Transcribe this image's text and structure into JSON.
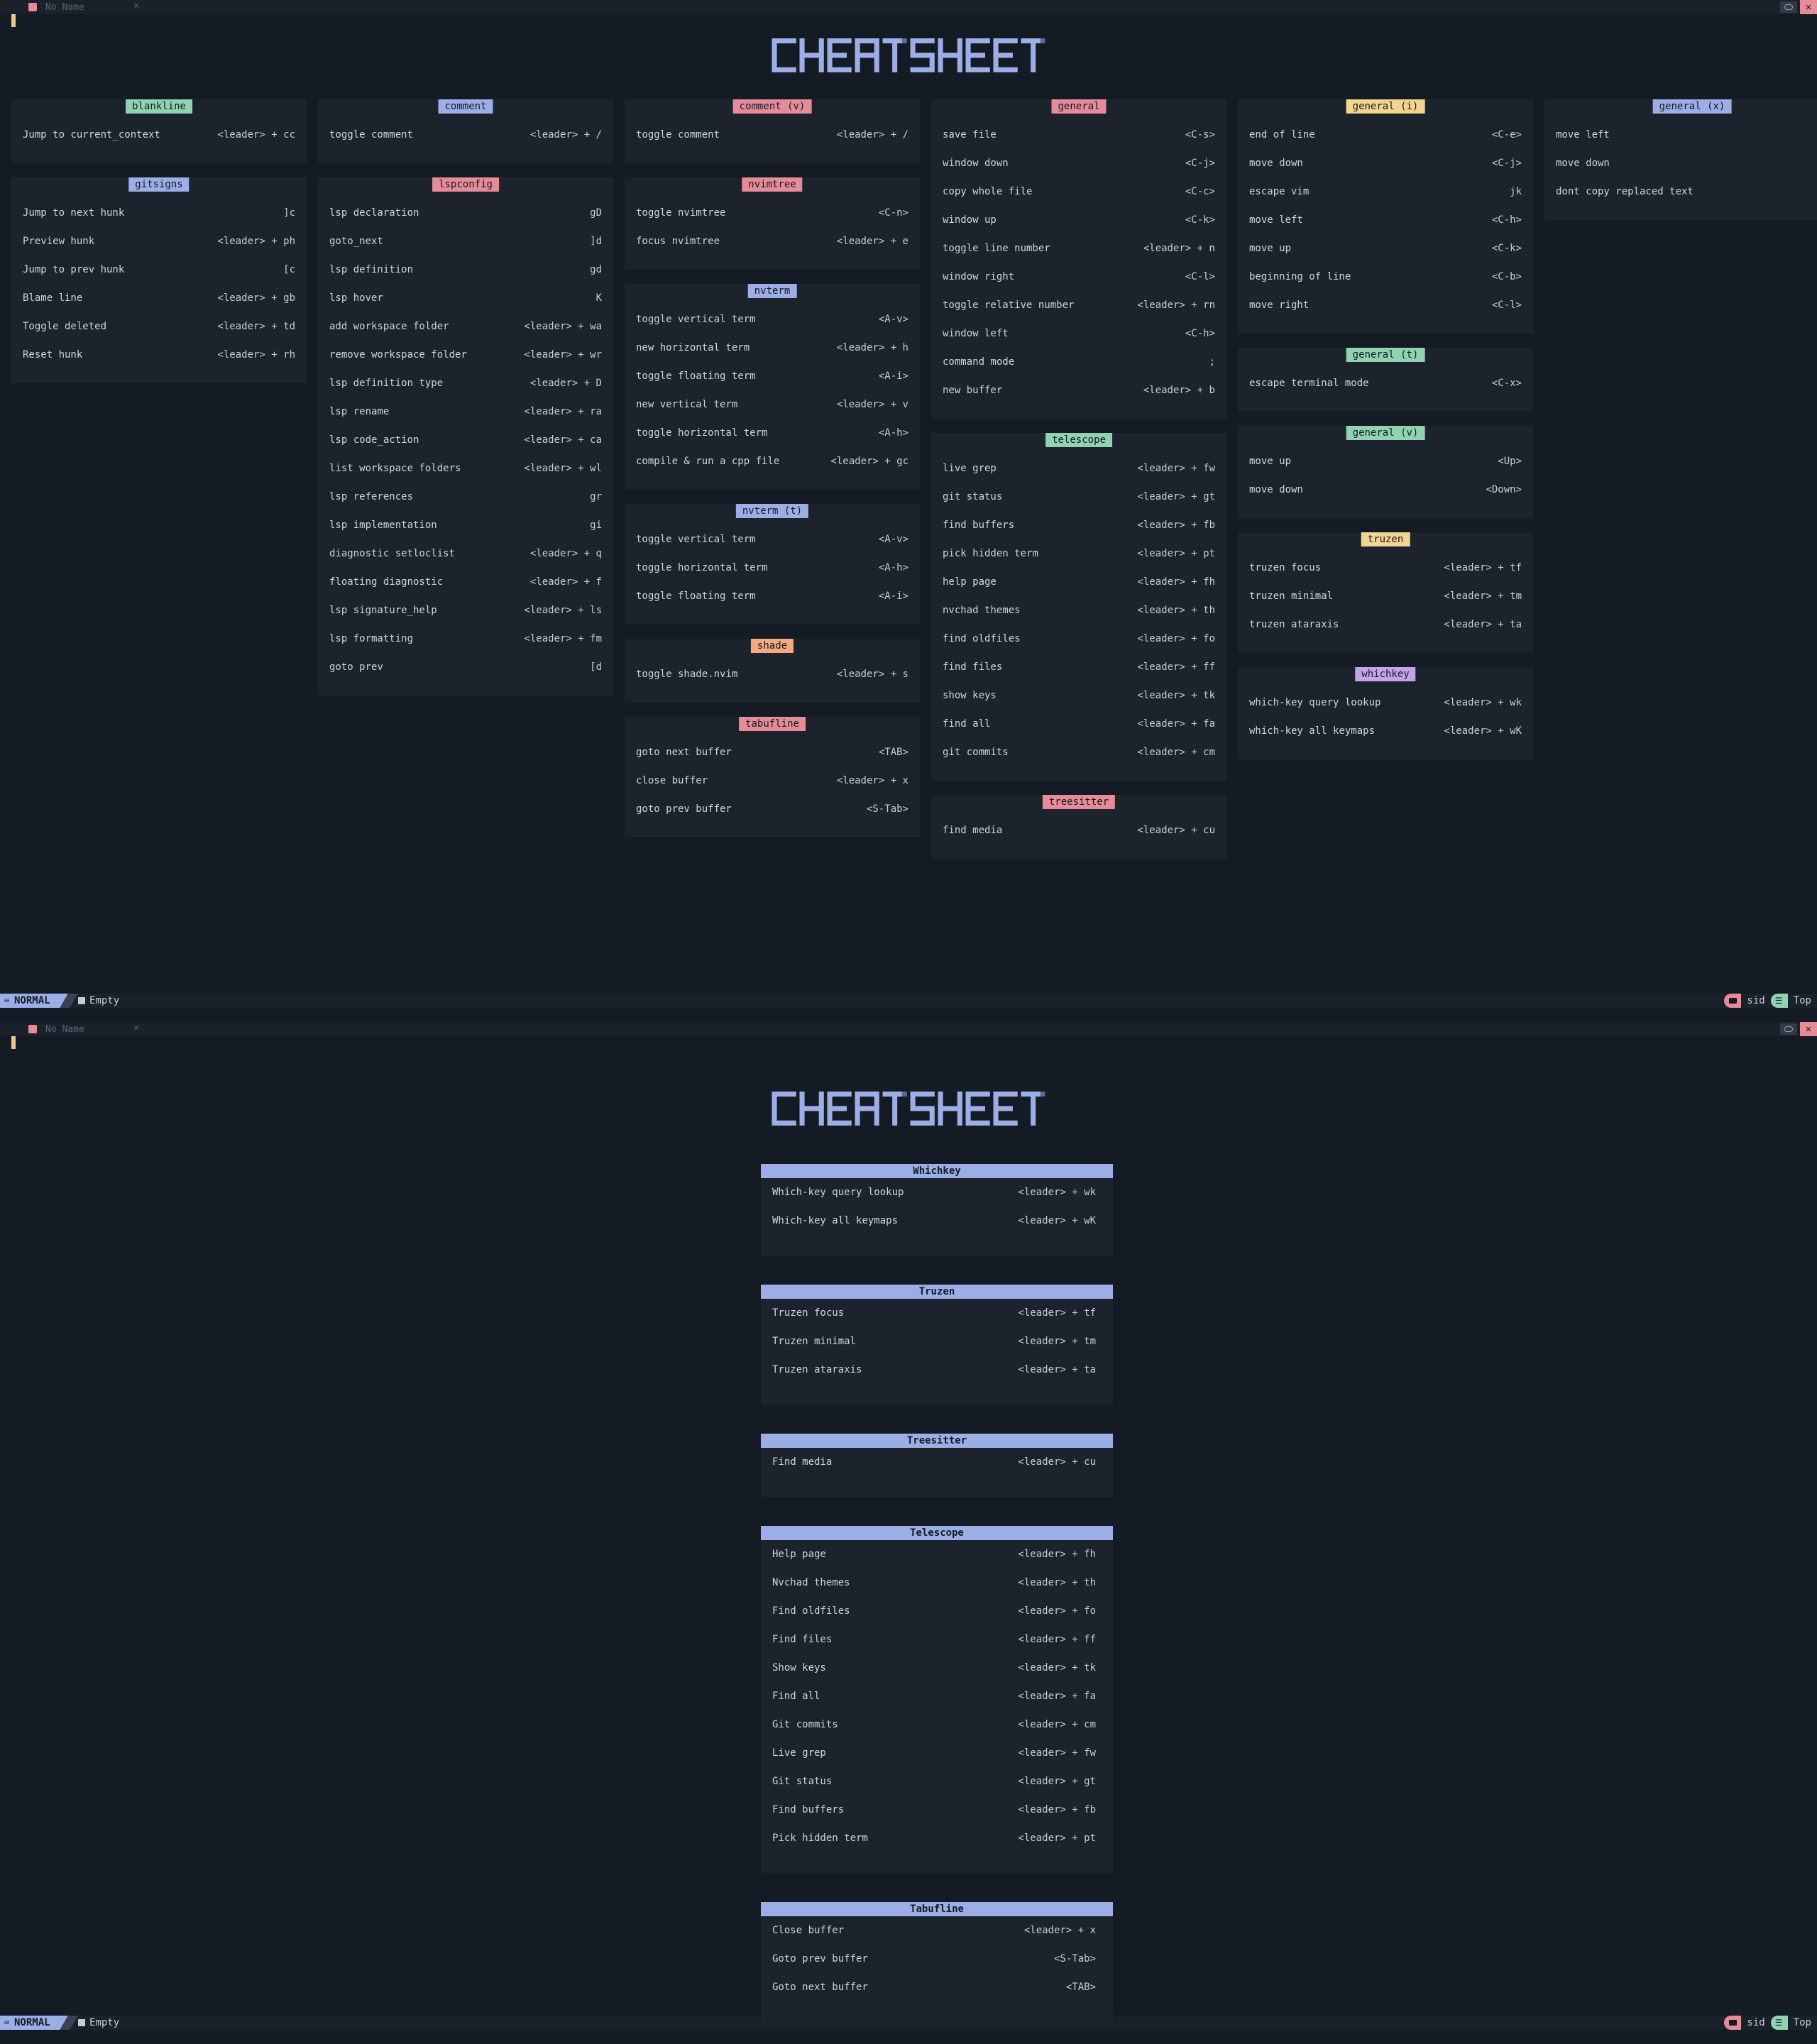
{
  "tabline": {
    "buffer_name": "No Name",
    "close": "×"
  },
  "statusline": {
    "mode": "NORMAL",
    "file": "Empty",
    "cwd": "sid",
    "position": "Top"
  },
  "colors": {
    "green": "#8fd3b0",
    "blue": "#9caee6",
    "red": "#e58c98",
    "orange": "#f5a97f",
    "yellow": "#f3d590",
    "purple": "#c5a3e8",
    "bg": "#141b24",
    "card": "#1c232d"
  },
  "grid": [
    {
      "title": "blankline",
      "color": "green",
      "items": [
        [
          "Jump to current_context",
          "<leader> + cc"
        ]
      ]
    },
    {
      "title": "comment",
      "color": "blue",
      "items": [
        [
          "toggle comment",
          "<leader> + /"
        ]
      ]
    },
    {
      "title": "comment (v)",
      "color": "red",
      "items": [
        [
          "toggle comment",
          "<leader> + /"
        ]
      ]
    },
    {
      "title": "general",
      "color": "red",
      "items": [
        [
          "save file",
          "<C-s>"
        ],
        [
          "window down",
          "<C-j>"
        ],
        [
          "copy whole file",
          "<C-c>"
        ],
        [
          "window up",
          "<C-k>"
        ],
        [
          "toggle line number",
          "<leader> + n"
        ],
        [
          "window right",
          "<C-l>"
        ],
        [
          "toggle relative number",
          "<leader> + rn"
        ],
        [
          "window left",
          "<C-h>"
        ],
        [
          "command mode",
          ";"
        ],
        [
          "new buffer",
          "<leader> + b"
        ]
      ]
    },
    {
      "title": "general (i)",
      "color": "yellow",
      "items": [
        [
          "end of line",
          "<C-e>"
        ],
        [
          "move down",
          "<C-j>"
        ],
        [
          "escape vim",
          "jk"
        ],
        [
          "move left",
          "<C-h>"
        ],
        [
          "move up",
          "<C-k>"
        ],
        [
          "beginning of line",
          "<C-b>"
        ],
        [
          "move right",
          "<C-l>"
        ]
      ]
    },
    {
      "title": "general (x)",
      "color": "blue",
      "items": [
        [
          "move left",
          ""
        ],
        [
          "move down",
          ""
        ],
        [
          "dont copy replaced text",
          ""
        ]
      ]
    },
    {
      "title": "gitsigns",
      "color": "blue",
      "items": [
        [
          "Jump to next hunk",
          "]c"
        ],
        [
          "Preview hunk",
          "<leader> + ph"
        ],
        [
          "Jump to prev hunk",
          "[c"
        ],
        [
          "Blame line",
          "<leader> + gb"
        ],
        [
          "Toggle deleted",
          "<leader> + td"
        ],
        [
          "Reset hunk",
          "<leader> + rh"
        ]
      ]
    },
    {
      "title": "lspconfig",
      "color": "red",
      "items": [
        [
          "lsp declaration",
          "gD"
        ],
        [
          "goto_next",
          "]d"
        ],
        [
          "lsp definition",
          "gd"
        ],
        [
          "lsp hover",
          "K"
        ],
        [
          "add workspace folder",
          "<leader> + wa"
        ],
        [
          "remove workspace folder",
          "<leader> + wr"
        ],
        [
          "lsp definition type",
          "<leader> + D"
        ],
        [
          "lsp rename",
          "<leader> + ra"
        ],
        [
          "lsp code_action",
          "<leader> + ca"
        ],
        [
          "list workspace folders",
          "<leader> + wl"
        ],
        [
          "lsp references",
          "gr"
        ],
        [
          "lsp implementation",
          "gi"
        ],
        [
          "diagnostic setloclist",
          "<leader> + q"
        ],
        [
          "floating diagnostic",
          "<leader> + f"
        ],
        [
          "lsp signature_help",
          "<leader> + ls"
        ],
        [
          "lsp formatting",
          "<leader> + fm"
        ],
        [
          "goto prev",
          "[d"
        ]
      ]
    },
    {
      "title": "nvimtree",
      "color": "red",
      "items": [
        [
          "toggle nvimtree",
          "<C-n>"
        ],
        [
          "focus nvimtree",
          "<leader> + e"
        ]
      ]
    },
    {
      "title": "nvterm",
      "color": "blue",
      "items": [
        [
          "toggle vertical term",
          "<A-v>"
        ],
        [
          "new horizontal term",
          "<leader> + h"
        ],
        [
          "toggle floating term",
          "<A-i>"
        ],
        [
          "new vertical term",
          "<leader> + v"
        ],
        [
          "toggle horizontal term",
          "<A-h>"
        ],
        [
          "compile & run a cpp file",
          "<leader> + gc"
        ]
      ]
    },
    {
      "title": "nvterm (t)",
      "color": "blue",
      "items": [
        [
          "toggle vertical term",
          "<A-v>"
        ],
        [
          "toggle horizontal term",
          "<A-h>"
        ],
        [
          "toggle floating term",
          "<A-i>"
        ]
      ]
    },
    {
      "title": "shade",
      "color": "orange",
      "items": [
        [
          "toggle shade.nvim",
          "<leader> + s"
        ]
      ]
    },
    {
      "title": "tabufline",
      "color": "red",
      "items": [
        [
          "goto next buffer",
          "<TAB>"
        ],
        [
          "close buffer",
          "<leader> + x"
        ],
        [
          "goto prev buffer",
          "<S-Tab>"
        ]
      ]
    },
    {
      "title": "telescope",
      "color": "green",
      "items": [
        [
          "live grep",
          "<leader> + fw"
        ],
        [
          "git status",
          "<leader> + gt"
        ],
        [
          "find buffers",
          "<leader> + fb"
        ],
        [
          "pick hidden term",
          "<leader> + pt"
        ],
        [
          "help page",
          "<leader> + fh"
        ],
        [
          "nvchad themes",
          "<leader> + th"
        ],
        [
          "find oldfiles",
          "<leader> + fo"
        ],
        [
          "find files",
          "<leader> + ff"
        ],
        [
          "show keys",
          "<leader> + tk"
        ],
        [
          "find all",
          "<leader> + fa"
        ],
        [
          "git commits",
          "<leader> + cm"
        ]
      ]
    },
    {
      "title": "treesitter",
      "color": "red",
      "items": [
        [
          "find media",
          "<leader> + cu"
        ]
      ]
    },
    {
      "title": "general (t)",
      "color": "green",
      "items": [
        [
          "escape terminal mode",
          "<C-x>"
        ]
      ]
    },
    {
      "title": "general (v)",
      "color": "green",
      "items": [
        [
          "move up",
          "<Up>"
        ],
        [
          "move down",
          "<Down>"
        ]
      ]
    },
    {
      "title": "truzen",
      "color": "yellow",
      "items": [
        [
          "truzen focus",
          "<leader> + tf"
        ],
        [
          "truzen minimal",
          "<leader> + tm"
        ],
        [
          "truzen ataraxis",
          "<leader> + ta"
        ]
      ]
    },
    {
      "title": "whichkey",
      "color": "purple",
      "items": [
        [
          "which-key query lookup",
          "<leader> + wk"
        ],
        [
          "which-key all keymaps",
          "<leader> + wK"
        ]
      ]
    }
  ],
  "list": [
    {
      "title": "Whichkey",
      "items": [
        [
          "Which-key query lookup",
          "<leader> + wk"
        ],
        [
          "Which-key all keymaps",
          "<leader> + wK"
        ]
      ]
    },
    {
      "title": "Truzen",
      "items": [
        [
          "Truzen focus",
          "<leader> + tf"
        ],
        [
          "Truzen minimal",
          "<leader> + tm"
        ],
        [
          "Truzen ataraxis",
          "<leader> + ta"
        ]
      ]
    },
    {
      "title": "Treesitter",
      "items": [
        [
          "Find media",
          "<leader> + cu"
        ]
      ]
    },
    {
      "title": "Telescope",
      "items": [
        [
          "Help page",
          "<leader> + fh"
        ],
        [
          "Nvchad themes",
          "<leader> + th"
        ],
        [
          "Find oldfiles",
          "<leader> + fo"
        ],
        [
          "Find files",
          "<leader> + ff"
        ],
        [
          "Show keys",
          "<leader> + tk"
        ],
        [
          "Find all",
          "<leader> + fa"
        ],
        [
          "Git commits",
          "<leader> + cm"
        ],
        [
          "Live grep",
          "<leader> + fw"
        ],
        [
          "Git status",
          "<leader> + gt"
        ],
        [
          "Find buffers",
          "<leader> + fb"
        ],
        [
          "Pick hidden term",
          "<leader> + pt"
        ]
      ]
    },
    {
      "title": "Tabufline",
      "items": [
        [
          "Close buffer",
          "<leader> + x"
        ],
        [
          "Goto prev buffer",
          "<S-Tab>"
        ],
        [
          "Goto next buffer",
          "<TAB>"
        ]
      ]
    }
  ]
}
